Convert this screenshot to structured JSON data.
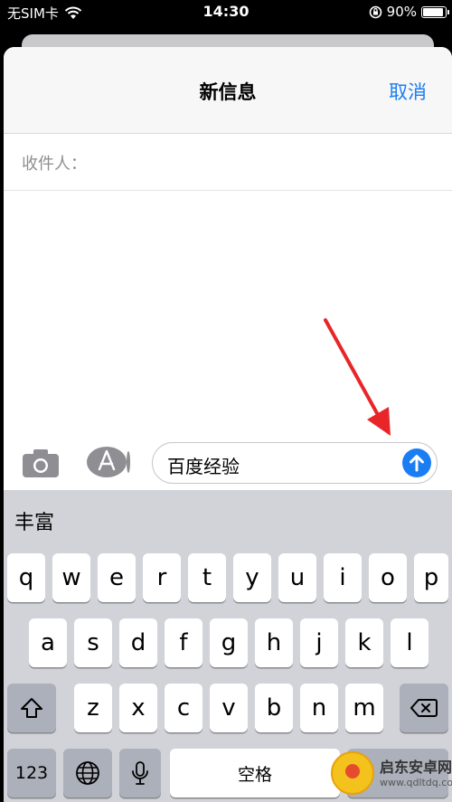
{
  "status_bar": {
    "carrier": "无SIM卡",
    "time": "14:30",
    "battery_percent": "90%",
    "battery_level": 0.9
  },
  "nav": {
    "title": "新信息",
    "cancel_label": "取消"
  },
  "recipient": {
    "label": "收件人："
  },
  "compose": {
    "message_text": "百度经验",
    "camera_icon": "camera-icon",
    "apps_icon": "app-store-icon",
    "send_icon": "send-arrow-up-icon"
  },
  "keyboard": {
    "suggestion": "丰富",
    "row1": [
      "q",
      "w",
      "e",
      "r",
      "t",
      "y",
      "u",
      "i",
      "o",
      "p"
    ],
    "row2": [
      "a",
      "s",
      "d",
      "f",
      "g",
      "h",
      "j",
      "k",
      "l"
    ],
    "row3": [
      "z",
      "x",
      "c",
      "v",
      "b",
      "n",
      "m"
    ],
    "numbers_label": "123",
    "space_label": "空格",
    "shift_icon": "shift-icon",
    "delete_icon": "delete-icon",
    "globe_icon": "globe-icon",
    "mic_icon": "microphone-icon"
  },
  "watermark": {
    "name": "启东安卓网",
    "url": "www.qdltdq.com"
  },
  "colors": {
    "accent": "#1a7ef2",
    "arrow": "#e8262a"
  }
}
